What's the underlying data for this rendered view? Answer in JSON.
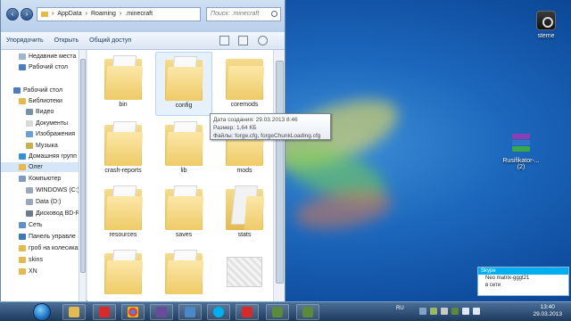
{
  "window": {
    "address_parts": [
      "AppData",
      "Roaming",
      ".minecraft"
    ],
    "search_placeholder": "Поиск: .minecraft",
    "toolbar": {
      "organize": "Упорядочить",
      "open": "Открыть",
      "share": "Общий доступ"
    }
  },
  "nav": [
    {
      "label": "Недавние места",
      "color": "#9fb6d2"
    },
    {
      "label": "Рабочий стол",
      "color": "#4d7cc2"
    },
    {
      "label": "Рабочий стол",
      "color": "#4d7cc2"
    },
    {
      "label": "Библиотеки",
      "color": "#e4b94e"
    },
    {
      "label": "Видео",
      "color": "#7a8fa8"
    },
    {
      "label": "Документы",
      "color": "#d9d9d9"
    },
    {
      "label": "Изображения",
      "color": "#6aa0d4"
    },
    {
      "label": "Музыка",
      "color": "#c9b04a"
    },
    {
      "label": "Домашняя групп",
      "color": "#3a8ed4"
    },
    {
      "label": "Олег",
      "color": "#e4b94e"
    },
    {
      "label": "Компьютер",
      "color": "#7d9cc2"
    },
    {
      "label": "WINDOWS (C:)",
      "color": "#9ba8b8"
    },
    {
      "label": "Data (D:)",
      "color": "#9ba8b8"
    },
    {
      "label": "Дисковод BD-R",
      "color": "#6c7a8a"
    },
    {
      "label": "Сеть",
      "color": "#5e8fc9"
    },
    {
      "label": "Панель управле",
      "color": "#3f77b8"
    },
    {
      "label": "гроб на колесиках",
      "color": "#e4b94e"
    },
    {
      "label": "skins",
      "color": "#e4b94e"
    },
    {
      "label": "XN",
      "color": "#e4b94e"
    }
  ],
  "folders": [
    {
      "name": "bin"
    },
    {
      "name": "config"
    },
    {
      "name": "coremods"
    },
    {
      "name": "crash-reports"
    },
    {
      "name": "lib"
    },
    {
      "name": "mods"
    },
    {
      "name": "resources"
    },
    {
      "name": "saves"
    },
    {
      "name": "stats"
    },
    {
      "name": ""
    },
    {
      "name": ""
    },
    {
      "name": ""
    }
  ],
  "tooltip": {
    "created": "Дата создания: 29.03.2013 8:46",
    "size": "Размер: 1,64 КБ",
    "files": "Файлы: forge.cfg, forgeChunkLoading.cfg"
  },
  "desktop": {
    "steam_label": "steme",
    "rar_label": "Rusifikator-...",
    "rar_sub": "(2)"
  },
  "skype": {
    "title": "Skype",
    "line1": "Neo matrix-gggt21",
    "line2": "в сети"
  },
  "taskbar": {
    "lang": "RU",
    "time": "13:40",
    "date": "29.03.2013"
  }
}
